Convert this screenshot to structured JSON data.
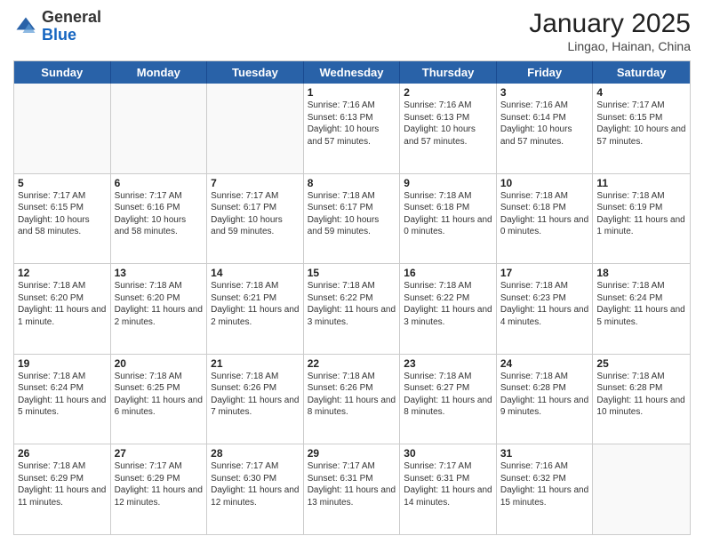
{
  "header": {
    "logo_general": "General",
    "logo_blue": "Blue",
    "month_title": "January 2025",
    "location": "Lingao, Hainan, China"
  },
  "days_of_week": [
    "Sunday",
    "Monday",
    "Tuesday",
    "Wednesday",
    "Thursday",
    "Friday",
    "Saturday"
  ],
  "rows": [
    [
      {
        "day": "",
        "info": ""
      },
      {
        "day": "",
        "info": ""
      },
      {
        "day": "",
        "info": ""
      },
      {
        "day": "1",
        "info": "Sunrise: 7:16 AM\nSunset: 6:13 PM\nDaylight: 10 hours and 57 minutes."
      },
      {
        "day": "2",
        "info": "Sunrise: 7:16 AM\nSunset: 6:13 PM\nDaylight: 10 hours and 57 minutes."
      },
      {
        "day": "3",
        "info": "Sunrise: 7:16 AM\nSunset: 6:14 PM\nDaylight: 10 hours and 57 minutes."
      },
      {
        "day": "4",
        "info": "Sunrise: 7:17 AM\nSunset: 6:15 PM\nDaylight: 10 hours and 57 minutes."
      }
    ],
    [
      {
        "day": "5",
        "info": "Sunrise: 7:17 AM\nSunset: 6:15 PM\nDaylight: 10 hours and 58 minutes."
      },
      {
        "day": "6",
        "info": "Sunrise: 7:17 AM\nSunset: 6:16 PM\nDaylight: 10 hours and 58 minutes."
      },
      {
        "day": "7",
        "info": "Sunrise: 7:17 AM\nSunset: 6:17 PM\nDaylight: 10 hours and 59 minutes."
      },
      {
        "day": "8",
        "info": "Sunrise: 7:18 AM\nSunset: 6:17 PM\nDaylight: 10 hours and 59 minutes."
      },
      {
        "day": "9",
        "info": "Sunrise: 7:18 AM\nSunset: 6:18 PM\nDaylight: 11 hours and 0 minutes."
      },
      {
        "day": "10",
        "info": "Sunrise: 7:18 AM\nSunset: 6:18 PM\nDaylight: 11 hours and 0 minutes."
      },
      {
        "day": "11",
        "info": "Sunrise: 7:18 AM\nSunset: 6:19 PM\nDaylight: 11 hours and 1 minute."
      }
    ],
    [
      {
        "day": "12",
        "info": "Sunrise: 7:18 AM\nSunset: 6:20 PM\nDaylight: 11 hours and 1 minute."
      },
      {
        "day": "13",
        "info": "Sunrise: 7:18 AM\nSunset: 6:20 PM\nDaylight: 11 hours and 2 minutes."
      },
      {
        "day": "14",
        "info": "Sunrise: 7:18 AM\nSunset: 6:21 PM\nDaylight: 11 hours and 2 minutes."
      },
      {
        "day": "15",
        "info": "Sunrise: 7:18 AM\nSunset: 6:22 PM\nDaylight: 11 hours and 3 minutes."
      },
      {
        "day": "16",
        "info": "Sunrise: 7:18 AM\nSunset: 6:22 PM\nDaylight: 11 hours and 3 minutes."
      },
      {
        "day": "17",
        "info": "Sunrise: 7:18 AM\nSunset: 6:23 PM\nDaylight: 11 hours and 4 minutes."
      },
      {
        "day": "18",
        "info": "Sunrise: 7:18 AM\nSunset: 6:24 PM\nDaylight: 11 hours and 5 minutes."
      }
    ],
    [
      {
        "day": "19",
        "info": "Sunrise: 7:18 AM\nSunset: 6:24 PM\nDaylight: 11 hours and 5 minutes."
      },
      {
        "day": "20",
        "info": "Sunrise: 7:18 AM\nSunset: 6:25 PM\nDaylight: 11 hours and 6 minutes."
      },
      {
        "day": "21",
        "info": "Sunrise: 7:18 AM\nSunset: 6:26 PM\nDaylight: 11 hours and 7 minutes."
      },
      {
        "day": "22",
        "info": "Sunrise: 7:18 AM\nSunset: 6:26 PM\nDaylight: 11 hours and 8 minutes."
      },
      {
        "day": "23",
        "info": "Sunrise: 7:18 AM\nSunset: 6:27 PM\nDaylight: 11 hours and 8 minutes."
      },
      {
        "day": "24",
        "info": "Sunrise: 7:18 AM\nSunset: 6:28 PM\nDaylight: 11 hours and 9 minutes."
      },
      {
        "day": "25",
        "info": "Sunrise: 7:18 AM\nSunset: 6:28 PM\nDaylight: 11 hours and 10 minutes."
      }
    ],
    [
      {
        "day": "26",
        "info": "Sunrise: 7:18 AM\nSunset: 6:29 PM\nDaylight: 11 hours and 11 minutes."
      },
      {
        "day": "27",
        "info": "Sunrise: 7:17 AM\nSunset: 6:29 PM\nDaylight: 11 hours and 12 minutes."
      },
      {
        "day": "28",
        "info": "Sunrise: 7:17 AM\nSunset: 6:30 PM\nDaylight: 11 hours and 12 minutes."
      },
      {
        "day": "29",
        "info": "Sunrise: 7:17 AM\nSunset: 6:31 PM\nDaylight: 11 hours and 13 minutes."
      },
      {
        "day": "30",
        "info": "Sunrise: 7:17 AM\nSunset: 6:31 PM\nDaylight: 11 hours and 14 minutes."
      },
      {
        "day": "31",
        "info": "Sunrise: 7:16 AM\nSunset: 6:32 PM\nDaylight: 11 hours and 15 minutes."
      },
      {
        "day": "",
        "info": ""
      }
    ]
  ]
}
